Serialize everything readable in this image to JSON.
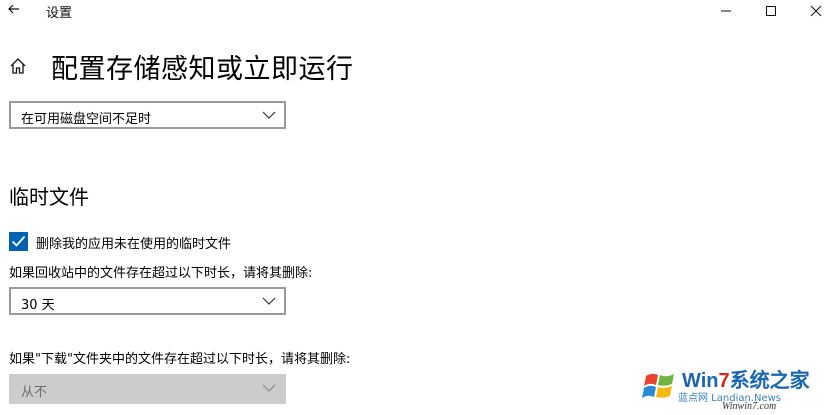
{
  "window": {
    "title": "设置"
  },
  "page": {
    "title": "配置存储感知或立即运行"
  },
  "run_schedule": {
    "selected": "在可用磁盘空间不足时"
  },
  "temp_files": {
    "heading": "临时文件",
    "delete_temp_checkbox": {
      "label": "删除我的应用未在使用的临时文件",
      "checked": true
    },
    "recycle_bin": {
      "description": "如果回收站中的文件存在超过以下时长，请将其删除:",
      "selected": "30 天"
    },
    "downloads": {
      "description": "如果\"下载\"文件夹中的文件存在超过以下时长，请将其删除:",
      "selected": "从不",
      "disabled": true
    }
  },
  "watermark": {
    "brand_part1": "Win",
    "brand_part2": "7",
    "brand_part3": "系统之家",
    "sub": "蓝点网 Landian.News",
    "url": "Winwin7.com"
  },
  "colors": {
    "accent": "#0063b1",
    "disabled_bg": "#cccccc",
    "border": "#999999"
  },
  "icons": [
    "back-arrow-icon",
    "minimize-icon",
    "maximize-icon",
    "close-icon",
    "home-icon",
    "chevron-down-icon",
    "checkmark-icon"
  ]
}
